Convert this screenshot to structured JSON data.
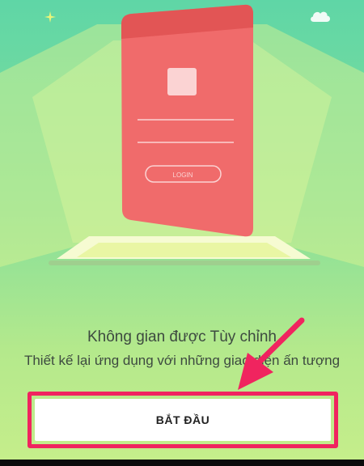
{
  "illustration": {
    "login_button_label": "LOGIN"
  },
  "onboarding": {
    "title": "Không gian được Tùy chỉnh",
    "subtitle": "Thiết kế lại ứng dụng với những giao diện ấn tượng"
  },
  "cta": {
    "label": "BẮT ĐẦU"
  },
  "colors": {
    "card": "#f06b6b",
    "card_header": "#e25555",
    "highlight": "#f0245f",
    "background_top": "#5fd6a6",
    "background_bottom": "#c6ee8b"
  },
  "icons": [
    "sparkle-icon",
    "cloud-icon",
    "arrow-pointer-icon"
  ]
}
